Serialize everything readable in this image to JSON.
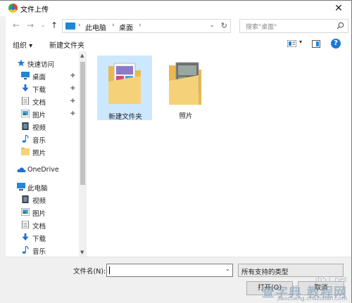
{
  "window": {
    "title": "文件上传",
    "close_glyph": "✕"
  },
  "nav": {
    "back_glyph": "←",
    "forward_glyph": "→",
    "recent_glyph": "⌄",
    "up_glyph": "↑",
    "crumbs": [
      "此电脑",
      "桌面"
    ],
    "sep_glyph": "›",
    "dropdown_glyph": "⌄",
    "refresh_glyph": "↻",
    "search_placeholder": "搜索\"桌面\""
  },
  "toolbar": {
    "organize": "组织 ▾",
    "new_folder": "新建文件夹",
    "help": "?",
    "view_dd": "▾"
  },
  "sidebar": {
    "items": [
      {
        "label": "快速访问",
        "icon": "star-icon",
        "pinned": false
      },
      {
        "label": "桌面",
        "icon": "desktop-icon",
        "pinned": true
      },
      {
        "label": "下载",
        "icon": "download-icon",
        "pinned": true
      },
      {
        "label": "文档",
        "icon": "document-icon",
        "pinned": true
      },
      {
        "label": "图片",
        "icon": "pictures-icon",
        "pinned": true
      },
      {
        "label": "视频",
        "icon": "video-icon",
        "pinned": false
      },
      {
        "label": "音乐",
        "icon": "music-icon",
        "pinned": false
      },
      {
        "label": "照片",
        "icon": "folder-icon",
        "pinned": false
      },
      {
        "label": "OneDrive",
        "icon": "cloud-icon",
        "pinned": false
      },
      {
        "label": "此电脑",
        "icon": "pc-icon",
        "pinned": false
      },
      {
        "label": "视频",
        "icon": "video-icon",
        "pinned": false
      },
      {
        "label": "图片",
        "icon": "pictures-icon",
        "pinned": false
      },
      {
        "label": "文档",
        "icon": "document-icon",
        "pinned": false
      },
      {
        "label": "下载",
        "icon": "download-icon",
        "pinned": false
      },
      {
        "label": "音乐",
        "icon": "music-icon",
        "pinned": false
      }
    ],
    "pin_glyph": "✚"
  },
  "files": [
    {
      "name": "新建文件夹",
      "selected": true
    },
    {
      "name": "照片",
      "selected": false
    }
  ],
  "bottom": {
    "filename_label": "文件名(N):",
    "filename_value": "",
    "filetype_value": "所有支持的类型",
    "open_label": "打开(O)",
    "cancel_label": "取消"
  },
  "watermark": {
    "line1": "jb51.net",
    "line2": "查字典 教程网",
    "line3": "jiaocheng.chazidian.com"
  },
  "colors": {
    "accent": "#1e88d8",
    "selection": "#cce8ff",
    "folder": "#f5d27a"
  }
}
